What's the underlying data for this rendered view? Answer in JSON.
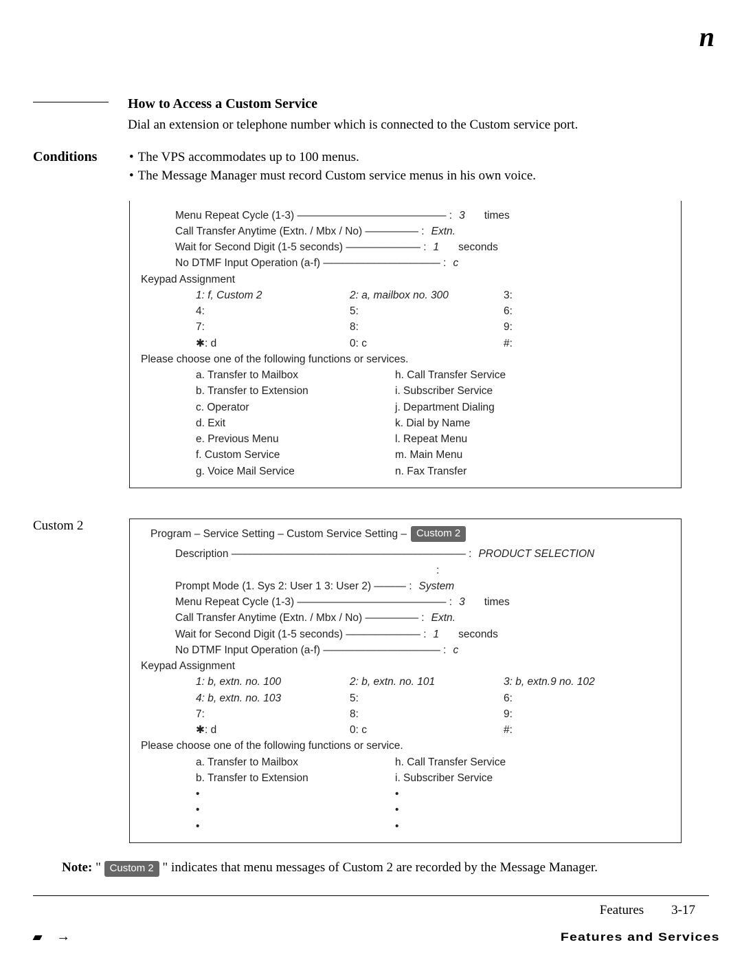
{
  "logo": "n",
  "title": "How to Access a Custom Service",
  "intro": "Dial an extension or telephone number which is connected to the Custom service port.",
  "conditions_label": "Conditions",
  "bullets": [
    "The VPS accommodates up to 100 menus.",
    "The Message Manager must record Custom service menus in his own voice."
  ],
  "panel1": {
    "menu_repeat_label": "Menu Repeat Cycle (1-3) ——————————————  :",
    "menu_repeat_val": "3",
    "menu_repeat_unit": "times",
    "call_transfer_label": "Call Transfer Anytime (Extn. / Mbx / No) ————— :",
    "call_transfer_val": "Extn.",
    "wait_label": "Wait for Second Digit (1-5 seconds) ——————— :",
    "wait_val": "1",
    "wait_unit": "seconds",
    "dtmf_label": "No DTMF Input Operation (a-f) ———————————  :",
    "dtmf_val": "c",
    "keypad_title": "Keypad Assignment",
    "kp": {
      "r1": {
        "c1": "1: f, Custom 2",
        "c2": "2: a, mailbox no. 300",
        "c3": "3:"
      },
      "r2": {
        "c1": "4:",
        "c2": "5:",
        "c3": "6:"
      },
      "r3": {
        "c1": "7:",
        "c2": "8:",
        "c3": "9:"
      },
      "r4": {
        "c1": "✱: d",
        "c2": "0: c",
        "c3": "#:"
      }
    },
    "choose": "Please choose one of the following functions or services.",
    "fns": {
      "r1": {
        "a": "a. Transfer to Mailbox",
        "b": "h. Call Transfer Service"
      },
      "r2": {
        "a": "b. Transfer to Extension",
        "b": "i.  Subscriber Service"
      },
      "r3": {
        "a": "c. Operator",
        "b": "j.  Department Dialing"
      },
      "r4": {
        "a": "d. Exit",
        "b": "k. Dial by Name"
      },
      "r5": {
        "a": "e. Previous Menu",
        "b": "l.  Repeat Menu"
      },
      "r6": {
        "a": "f.  Custom Service",
        "b": "m. Main Menu"
      },
      "r7": {
        "a": "g. Voice Mail Service",
        "b": "n. Fax Transfer"
      }
    }
  },
  "custom2_label": "Custom 2",
  "panel2": {
    "program_prefix": "Program – Service Setting – Custom Service Setting –",
    "program_badge": "Custom 2",
    "desc_label": "Description ——————————————————————  :",
    "desc_val": "PRODUCT SELECTION",
    "prompt_label": "Prompt Mode (1. Sys  2: User 1  3: User 2) ——— :",
    "prompt_val": "System",
    "menu_repeat_label": "Menu Repeat Cycle (1-3) ——————————————  :",
    "menu_repeat_val": "3",
    "menu_repeat_unit": "times",
    "call_transfer_label": "Call Transfer Anytime (Extn. / Mbx / No) ————— :",
    "call_transfer_val": "Extn.",
    "wait_label": "Wait for Second Digit (1-5 seconds) ——————— :",
    "wait_val": "1",
    "wait_unit": "seconds",
    "dtmf_label": "No DTMF Input Operation (a-f) ———————————  :",
    "dtmf_val": "c",
    "keypad_title": "Keypad Assignment",
    "kp": {
      "r1": {
        "c1": "1: b, extn. no. 100",
        "c2": "2: b, extn. no. 101",
        "c3": "3: b, extn.9 no. 102"
      },
      "r2": {
        "c1": "4: b, extn. no. 103",
        "c2": "5:",
        "c3": "6:"
      },
      "r3": {
        "c1": "7:",
        "c2": "8:",
        "c3": "9:"
      },
      "r4": {
        "c1": "✱: d",
        "c2": "0: c",
        "c3": "#:"
      }
    },
    "choose": "Please choose one of the following functions or service.",
    "fns": {
      "r1": {
        "a": "a. Transfer to Mailbox",
        "b": "h. Call Transfer Service"
      },
      "r2": {
        "a": "b. Transfer to Extension",
        "b": "i.  Subscriber Service"
      }
    },
    "dotsA": "•",
    "dotsB": "•",
    "dotsC": "•"
  },
  "note_label": "Note:",
  "note_prefix": "\" ",
  "note_badge": "Custom 2",
  "note_suffix": " \" indicates that menu messages of Custom 2 are recorded by the Message Manager.",
  "footer_features": "Features",
  "footer_page": "3-17",
  "footer_band": "Features and Services"
}
